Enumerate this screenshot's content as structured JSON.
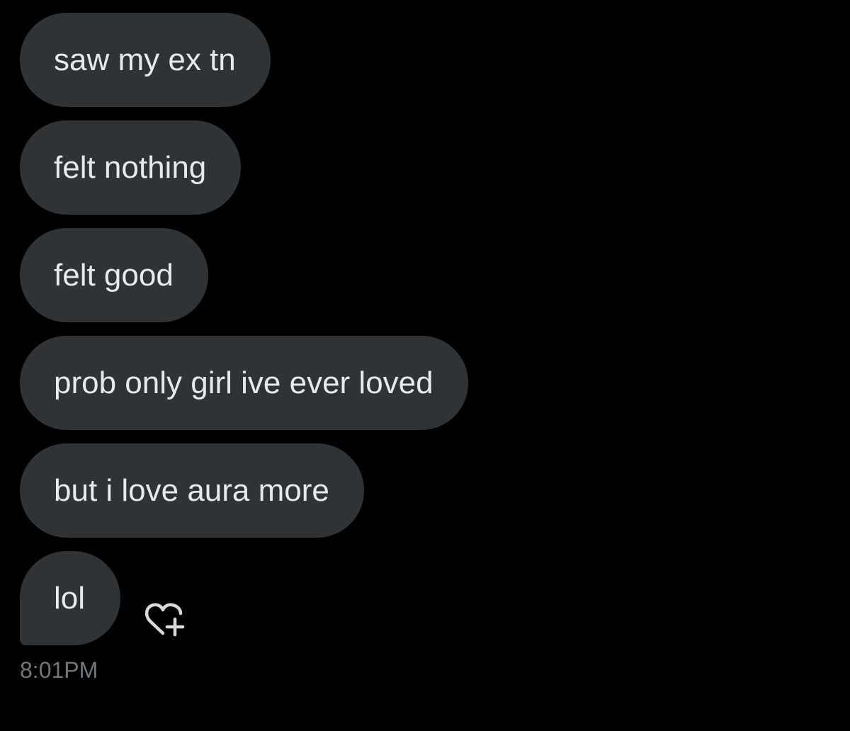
{
  "messages": [
    {
      "text": "saw my ex tn"
    },
    {
      "text": "felt nothing"
    },
    {
      "text": "felt good"
    },
    {
      "text": "prob only girl ive ever loved"
    },
    {
      "text": "but i love aura more"
    },
    {
      "text": "lol"
    }
  ],
  "timestamp": "8:01PM",
  "icons": {
    "react": "heart-plus-icon"
  },
  "colors": {
    "background": "#000000",
    "bubble": "#2f3336",
    "bubble_text": "#e7e9ea",
    "meta_text": "#71767b"
  }
}
